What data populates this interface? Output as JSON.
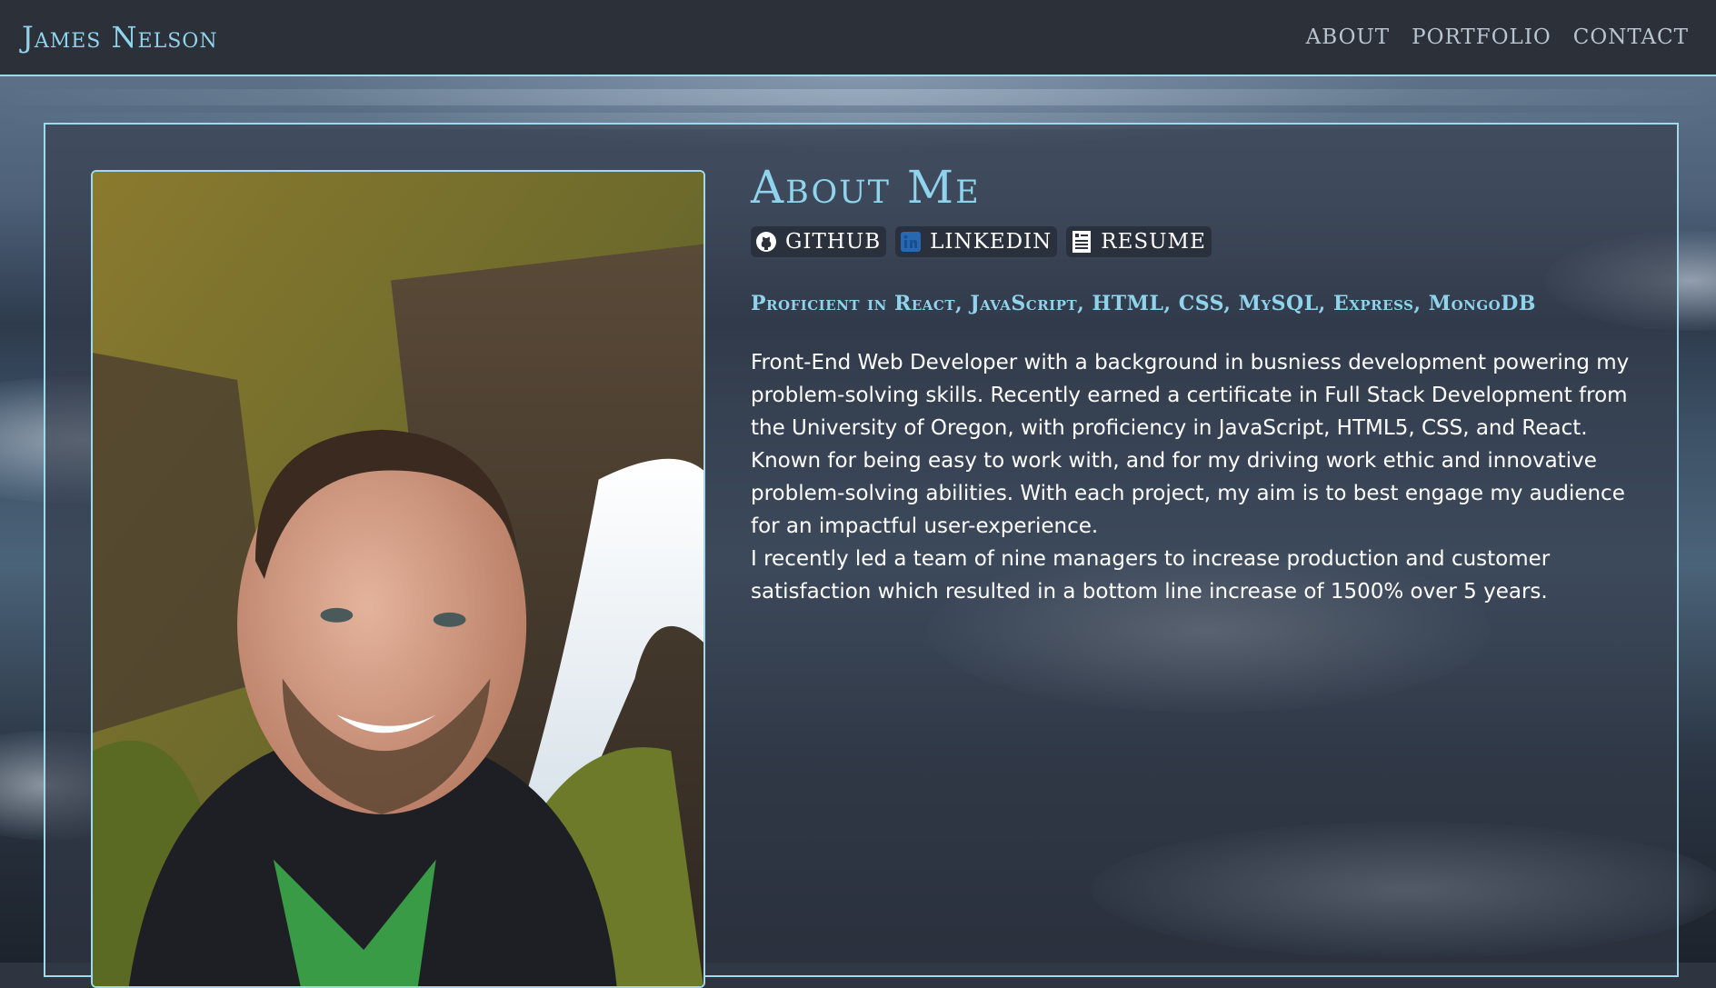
{
  "header": {
    "brand": "James Nelson",
    "nav": [
      "About",
      "Portfolio",
      "Contact"
    ]
  },
  "about": {
    "title": "About Me",
    "links": [
      {
        "label": "GitHub",
        "icon": "github-icon"
      },
      {
        "label": "LinkedIn",
        "icon": "linkedin-icon"
      },
      {
        "label": "Resume",
        "icon": "resume-icon"
      }
    ],
    "skills": "Proficient in React, JavaScript, HTML, CSS, MySQL, Express, MongoDB",
    "bio_1": "Front-End Web Developer with a background in busniess development powering my problem-solving skills. Recently earned a certificate in Full Stack Development from the University of Oregon, with proficiency in JavaScript, HTML5, CSS, and React. Known for being easy to work with, and for my driving work ethic and innovative problem-solving abilities. With each project, my aim is to best engage my audience for an impactful user-experience.",
    "bio_2": "I recently led a team of nine managers to increase production and customer satisfaction which resulted in a bottom line increase of 1500% over 5 years."
  },
  "colors": {
    "accent": "#8fd3ec",
    "header_bg": "#2c3039",
    "linkedin_blue": "#2867b2"
  }
}
